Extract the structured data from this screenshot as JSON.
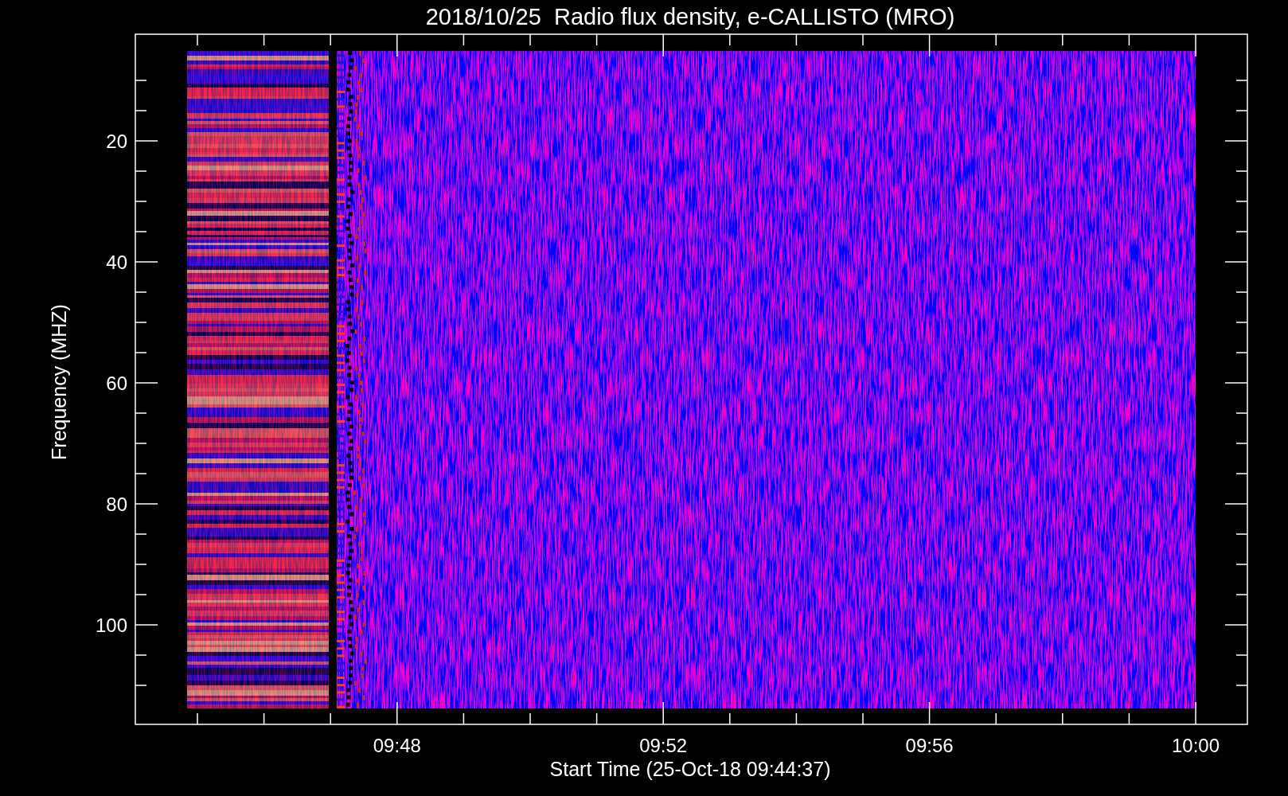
{
  "title": "2018/10/25  Radio flux density, e-CALLISTO (MRO)",
  "y_axis": {
    "label": "Frequency (MHZ)",
    "tick_labels": [
      "20",
      "40",
      "60",
      "80",
      "100"
    ]
  },
  "x_axis": {
    "label": "Start Time (25-Oct-18 09:44:37)",
    "tick_labels": [
      "09:48",
      "09:52",
      "09:56",
      "10:00"
    ]
  }
}
